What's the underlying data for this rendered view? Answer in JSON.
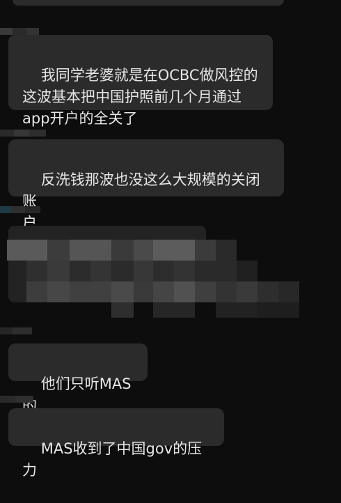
{
  "messages": [
    {
      "id": "m1",
      "text": "我同学老婆就是在OCBC做风控的\n这波基本把中国护照前几个月通过\napp开户的全关了"
    },
    {
      "id": "m2",
      "text": "反洗钱那波也没这么大规模的关闭账\n户"
    },
    {
      "id": "m3",
      "text": "他们只听MAS的"
    },
    {
      "id": "m4",
      "text": "MAS收到了中国gov的压力"
    }
  ],
  "colors": {
    "background": "#0d0d0d",
    "bubble": "#2b2b2b",
    "text": "#e6e6e6"
  }
}
